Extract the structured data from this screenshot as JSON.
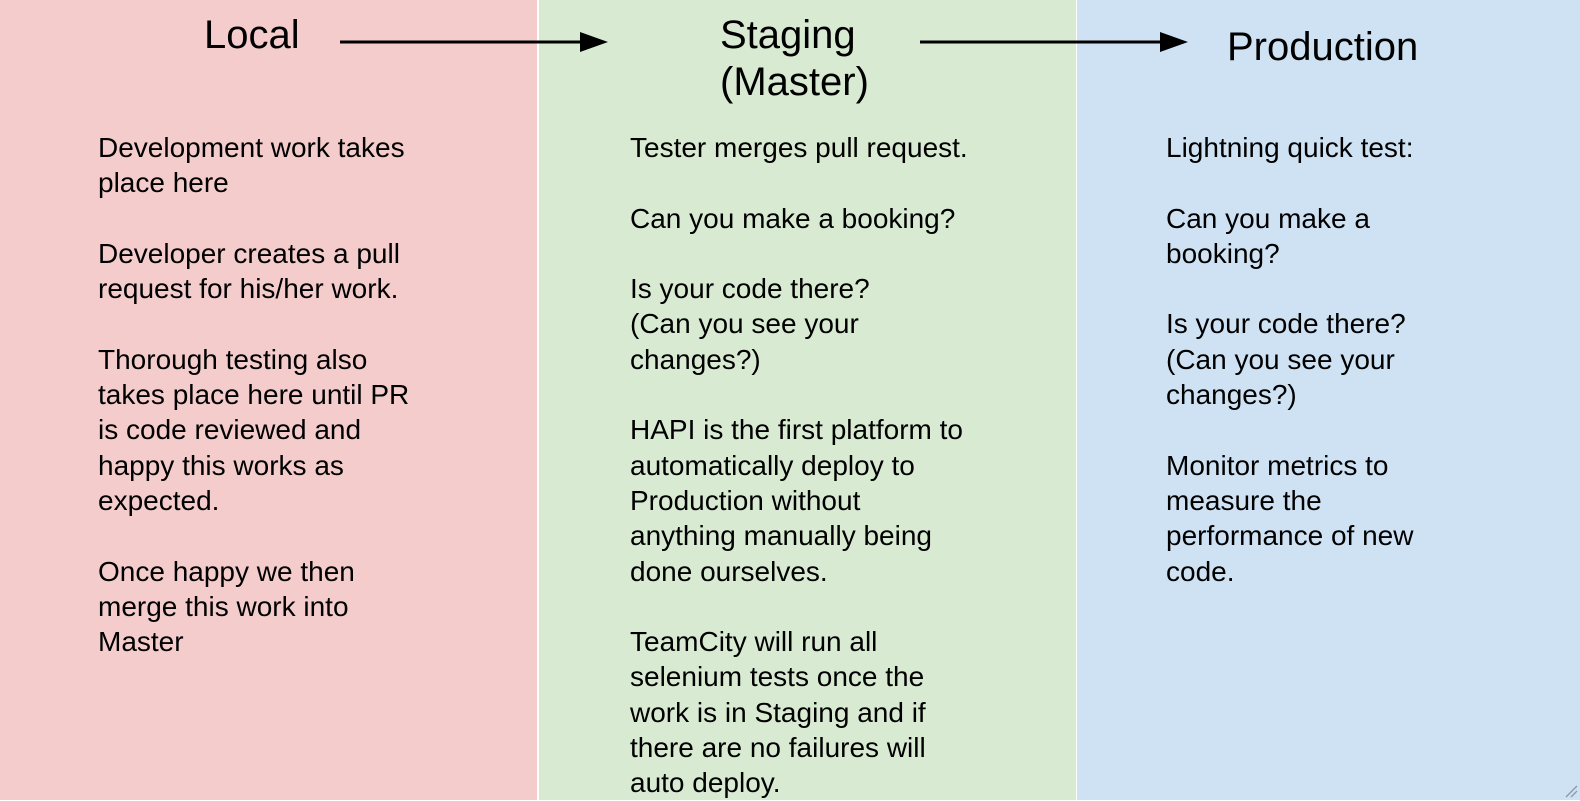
{
  "columns": {
    "local": {
      "title": "Local",
      "paragraphs": [
        "Development work takes\nplace here",
        "Developer creates a pull\nrequest for his/her work.",
        "Thorough testing also\ntakes place here until PR\nis code reviewed and\nhappy this works as\nexpected.",
        "Once happy we then\nmerge this work into\nMaster"
      ]
    },
    "staging": {
      "title": "Staging\n(Master)",
      "paragraphs": [
        "Tester merges pull request.",
        "Can you make a booking?",
        "Is your code there?\n(Can you see your\nchanges?)",
        "HAPI is the first platform to\nautomatically deploy to\nProduction without\nanything manually being\ndone ourselves.",
        "TeamCity will run all\nselenium tests once the\nwork is in Staging and if\nthere are no failures will\nauto deploy."
      ]
    },
    "production": {
      "title": "Production",
      "paragraphs": [
        "Lightning quick test:",
        "Can you make a\nbooking?",
        "Is your code there?\n(Can you see your\nchanges?)",
        "Monitor metrics to\nmeasure the\nperformance of new\ncode."
      ]
    }
  },
  "colors": {
    "local": "#f4cccc",
    "staging": "#d9ead3",
    "production": "#cfe2f3",
    "arrow": "#000000"
  }
}
